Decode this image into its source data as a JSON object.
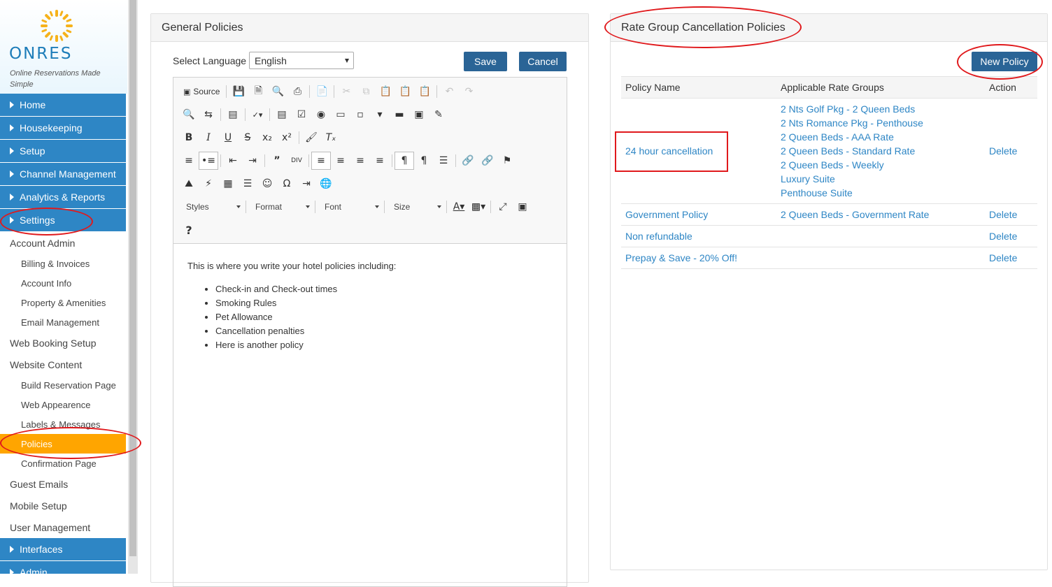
{
  "brand": {
    "name": "ONRES",
    "tagline": "Online Reservations Made Simple",
    "accent": "#2e86c5",
    "active_color": "#ffa500"
  },
  "sidebar": {
    "main_top": [
      {
        "label": "Home"
      },
      {
        "label": "Housekeeping"
      },
      {
        "label": "Setup"
      },
      {
        "label": "Channel Management"
      },
      {
        "label": "Analytics & Reports"
      },
      {
        "label": "Settings"
      }
    ],
    "settings_items": [
      {
        "label": "Account Admin",
        "level": 1
      },
      {
        "label": "Billing & Invoices",
        "level": 2
      },
      {
        "label": "Account Info",
        "level": 2
      },
      {
        "label": "Property & Amenities",
        "level": 2
      },
      {
        "label": "Email Management",
        "level": 2
      },
      {
        "label": "Web Booking Setup",
        "level": 1
      },
      {
        "label": "Website Content",
        "level": 1
      },
      {
        "label": "Build Reservation Page",
        "level": 2
      },
      {
        "label": "Web Appearence",
        "level": 2
      },
      {
        "label": "Labels & Messages",
        "level": 2
      },
      {
        "label": "Policies",
        "level": 2,
        "active": true
      },
      {
        "label": "Confirmation Page",
        "level": 2
      },
      {
        "label": "Guest Emails",
        "level": 1
      },
      {
        "label": "Mobile Setup",
        "level": 1
      },
      {
        "label": "User Management",
        "level": 1
      }
    ],
    "main_bottom": [
      {
        "label": "Interfaces"
      },
      {
        "label": "Admin"
      }
    ]
  },
  "general": {
    "title": "General Policies",
    "language_label": "Select Language",
    "language_value": "English",
    "save_label": "Save",
    "cancel_label": "Cancel",
    "toolbar": {
      "source_label": "Source",
      "styles_label": "Styles",
      "format_label": "Format",
      "font_label": "Font",
      "size_label": "Size",
      "help_label": "?"
    },
    "content": {
      "intro": "This is where you write your hotel policies including:",
      "items": [
        "Check-in and Check-out times",
        "Smoking Rules",
        "Pet Allowance",
        "Cancellation penalties",
        "Here is another policy"
      ]
    }
  },
  "rate_group": {
    "title": "Rate Group Cancellation Policies",
    "new_policy_label": "New Policy",
    "columns": [
      "Policy Name",
      "Applicable Rate Groups",
      "Action"
    ],
    "rows": [
      {
        "name": "24 hour cancellation",
        "groups": [
          "2 Nts Golf Pkg - 2 Queen Beds",
          "2 Nts Romance Pkg - Penthouse",
          "2 Queen Beds - AAA Rate",
          "2 Queen Beds - Standard Rate",
          "2 Queen Beds - Weekly",
          "Luxury Suite",
          "Penthouse Suite"
        ],
        "action": "Delete"
      },
      {
        "name": "Government Policy",
        "groups": [
          "2 Queen Beds - Government Rate"
        ],
        "action": "Delete"
      },
      {
        "name": "Non refundable",
        "groups": [],
        "action": "Delete"
      },
      {
        "name": "Prepay & Save - 20% Off!",
        "groups": [],
        "action": "Delete"
      }
    ]
  }
}
